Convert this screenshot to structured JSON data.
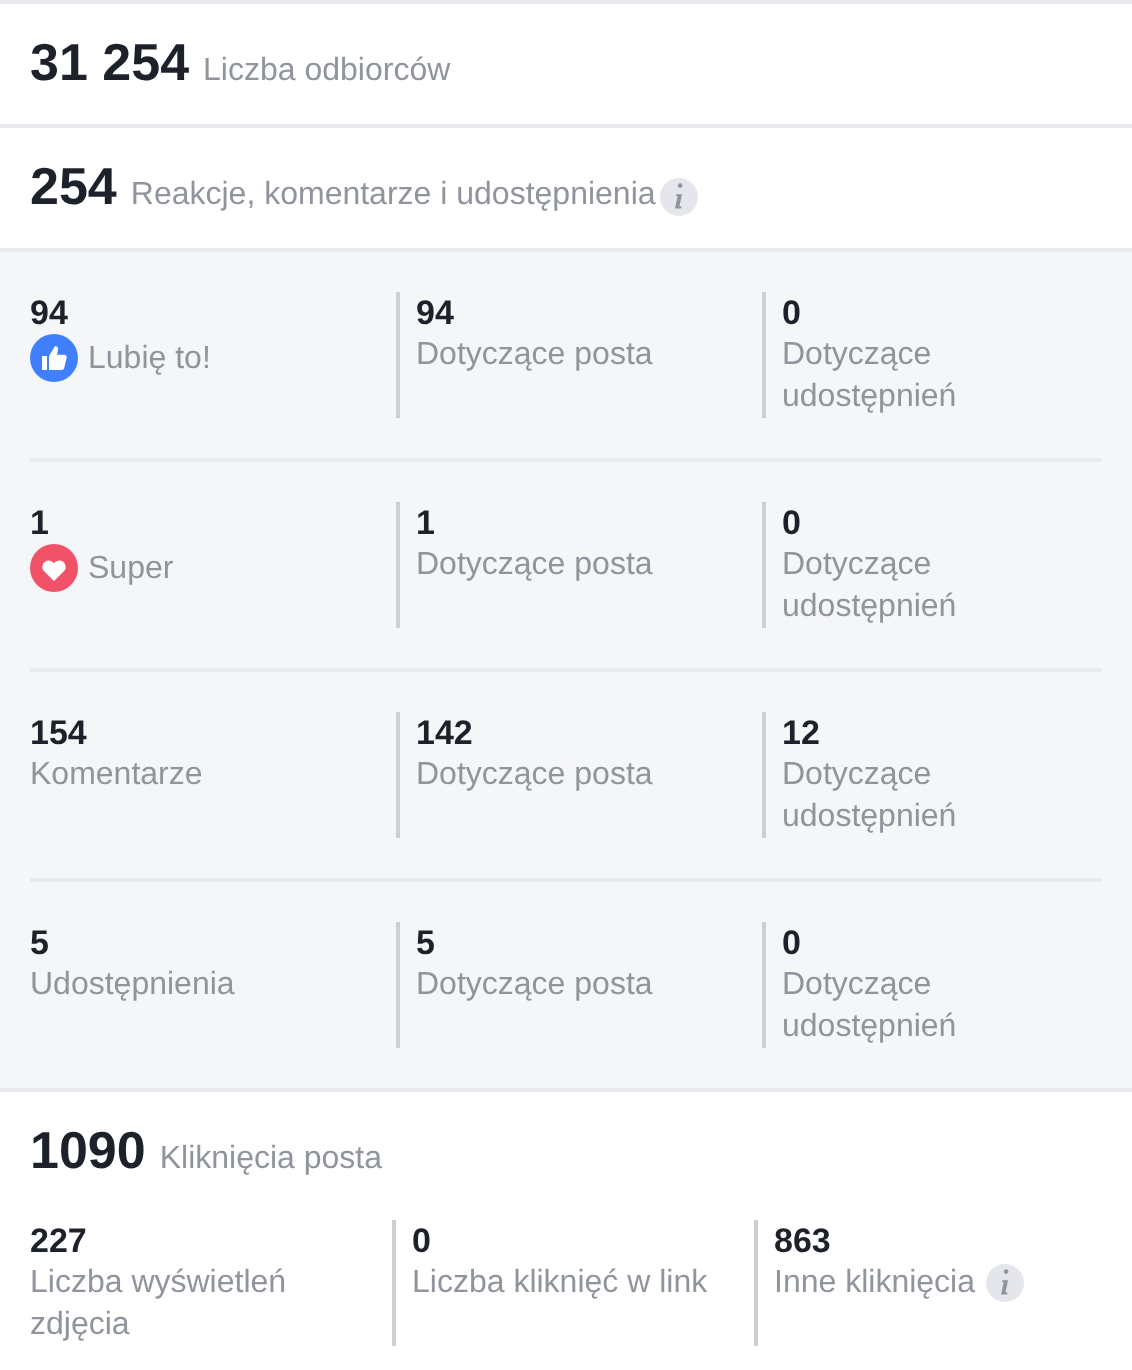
{
  "reach": {
    "value": "31 254",
    "label": "Liczba odbiorców",
    "info": false
  },
  "engagement": {
    "value": "254",
    "label": "Reakcje, komentarze i udostępnienia",
    "info": true
  },
  "engagement_rows": [
    {
      "kind": "like",
      "cells": [
        {
          "value": "94",
          "label": "Lubię to!"
        },
        {
          "value": "94",
          "label": "Dotyczące posta"
        },
        {
          "value": "0",
          "label": "Dotyczące udostępnień"
        }
      ]
    },
    {
      "kind": "love",
      "cells": [
        {
          "value": "1",
          "label": "Super"
        },
        {
          "value": "1",
          "label": "Dotyczące posta"
        },
        {
          "value": "0",
          "label": "Dotyczące udostępnień"
        }
      ]
    },
    {
      "kind": "plain",
      "cells": [
        {
          "value": "154",
          "label": "Komentarze"
        },
        {
          "value": "142",
          "label": "Dotyczące posta"
        },
        {
          "value": "12",
          "label": "Dotyczące udostępnień"
        }
      ]
    },
    {
      "kind": "plain",
      "cells": [
        {
          "value": "5",
          "label": "Udostępnienia"
        },
        {
          "value": "5",
          "label": "Dotyczące posta"
        },
        {
          "value": "0",
          "label": "Dotyczące udostępnień"
        }
      ]
    }
  ],
  "clicks": {
    "value": "1090",
    "label": "Kliknięcia posta",
    "info": false
  },
  "click_cells": [
    {
      "value": "227",
      "label": "Liczba wyświetleń zdjęcia",
      "info": false
    },
    {
      "value": "0",
      "label": "Liczba kliknięć w link",
      "info": false
    },
    {
      "value": "863",
      "label": "Inne kliknięcia",
      "info": true
    }
  ]
}
